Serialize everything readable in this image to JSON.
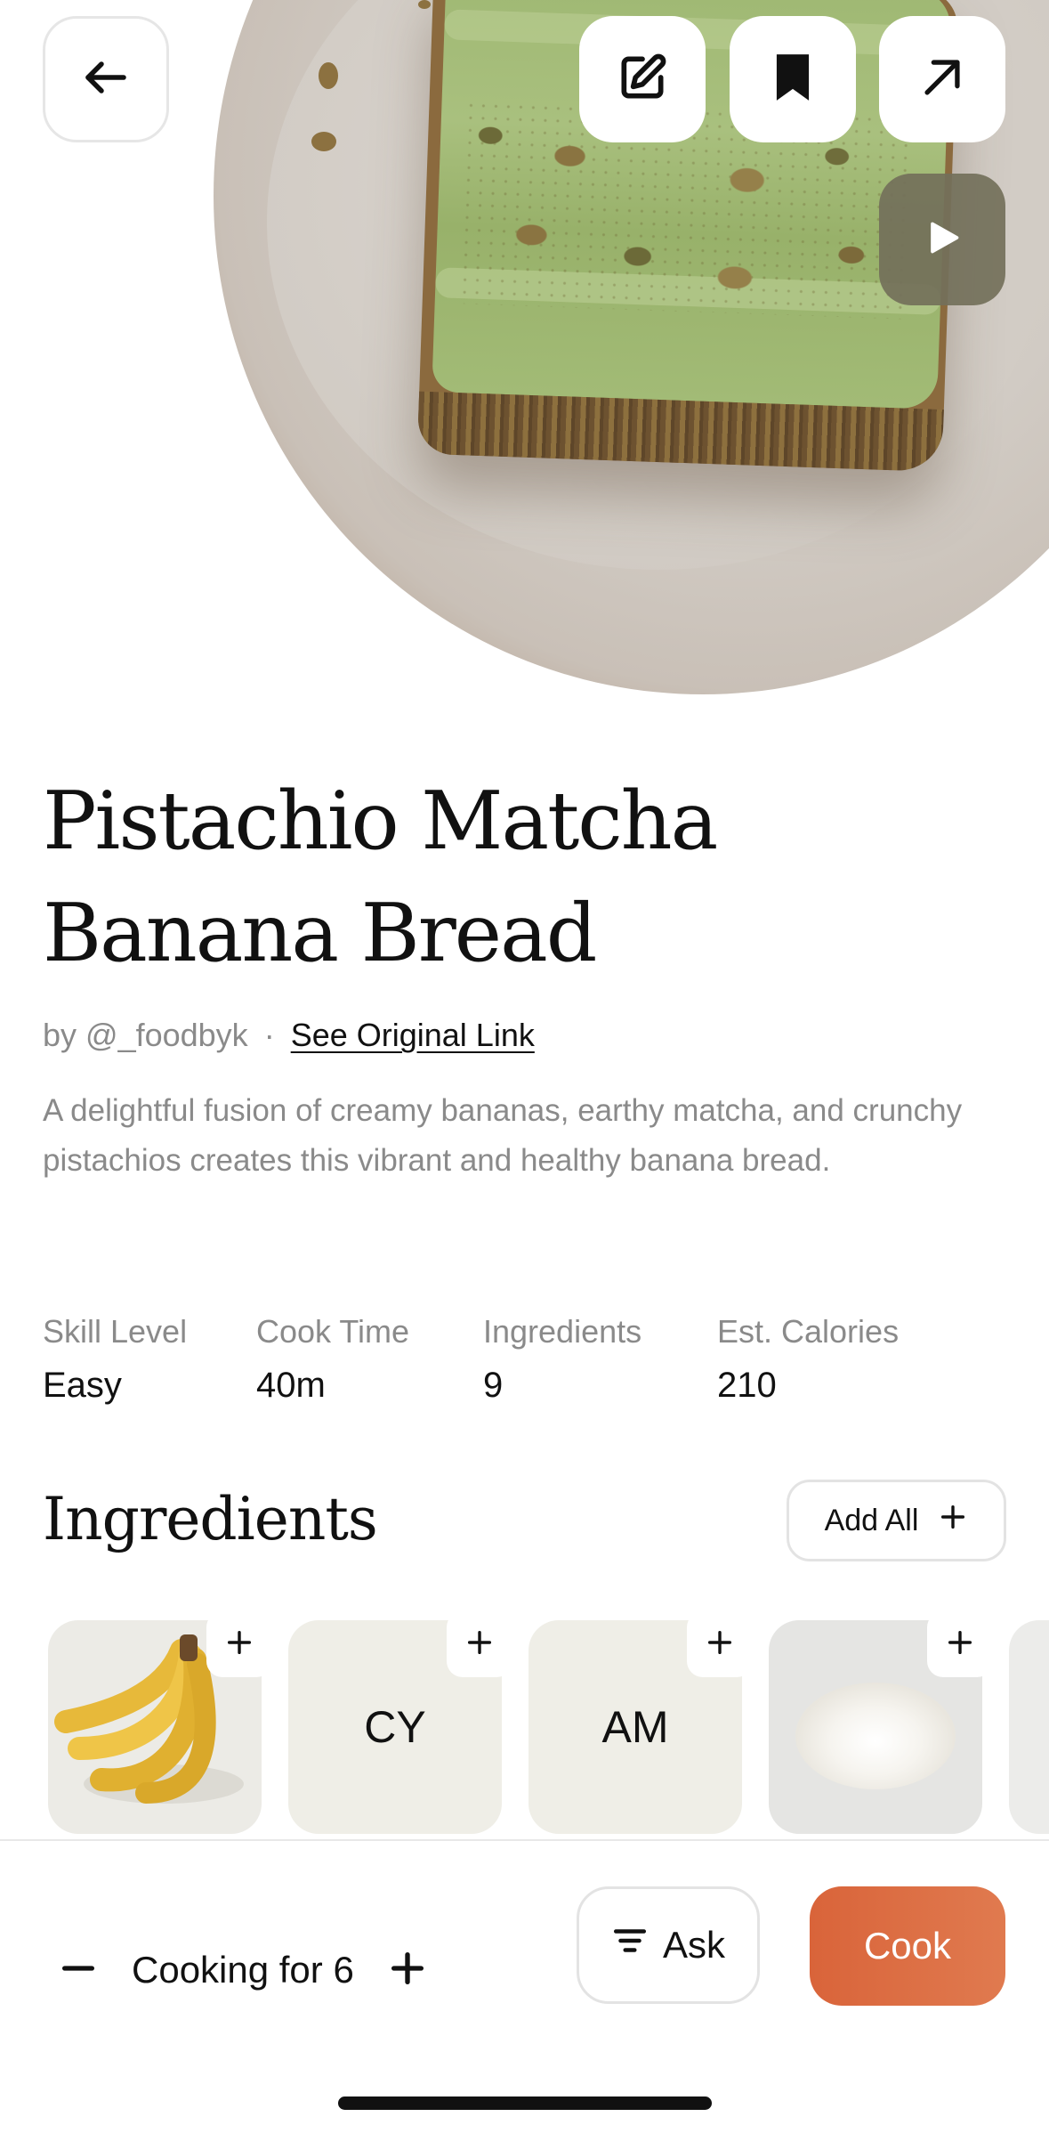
{
  "header": {
    "back_icon": "arrow-left-icon",
    "edit_icon": "edit-icon",
    "bookmark_icon": "bookmark-icon",
    "share_icon": "external-link-icon",
    "play_icon": "play-icon"
  },
  "recipe": {
    "title_line1": "Pistachio Matcha",
    "title_line2": "Banana Bread",
    "author": "by @_foodbyk",
    "separator": "·",
    "original_link": "See Original Link",
    "description": "A delightful fusion of creamy bananas, earthy matcha, and crunchy pistachios creates this vibrant and healthy banana bread."
  },
  "stats": [
    {
      "label": "Skill Level",
      "value": "Easy"
    },
    {
      "label": "Cook Time",
      "value": "40m"
    },
    {
      "label": "Ingredients",
      "value": "9"
    },
    {
      "label": "Est. Calories",
      "value": "210"
    }
  ],
  "ingredients": {
    "heading": "Ingredients",
    "add_all_label": "Add All",
    "items": [
      {
        "image": "banana-image",
        "initials": ""
      },
      {
        "image": "",
        "initials": "CY"
      },
      {
        "image": "",
        "initials": "AM"
      },
      {
        "image": "flour-image",
        "initials": ""
      }
    ]
  },
  "bottom_bar": {
    "servings_label": "Cooking for 6",
    "ask_label": "Ask",
    "cook_label": "Cook"
  },
  "colors": {
    "accent": "#d9643a",
    "ingredient_card_bg": "#efeee7"
  }
}
